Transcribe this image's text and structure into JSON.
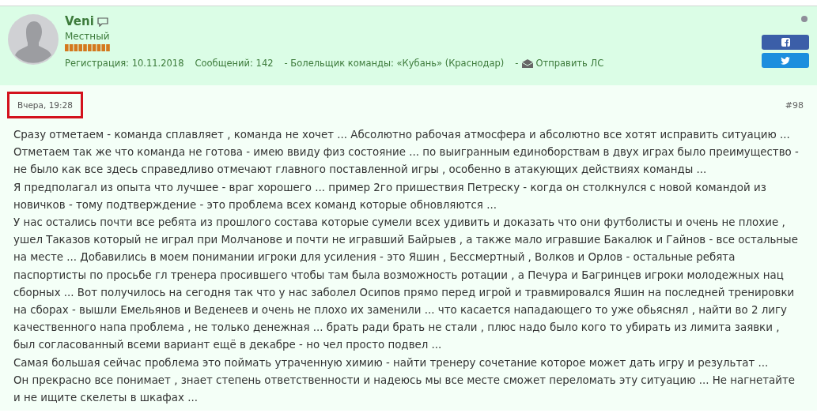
{
  "author": {
    "name": "Veni",
    "rank": "Местный",
    "online": false,
    "registration": "Регистрация: 10.11.2018",
    "messages": "Сообщений: 142",
    "fan": "- Болельщик команды: «Кубань» (Краснодар)",
    "separator": "-",
    "pm_link": "Отправить ЛС"
  },
  "post": {
    "date": "Вчера, 19:28",
    "date_highlighted": true,
    "number": "#98",
    "paragraphs": [
      "Сразу отметаем - команда сплавляет , команда не хочет ... Абсолютно рабочая атмосфера и абсолютно все хотят исправить ситуацию ... Отметаем так же что команда не готова - имею ввиду физ состояние ... по выигранным единоборствам в двух играх было преимущество - не было как все здесь справедливо отмечают главного поставленной игры , особенно в атакующих действиях команды ...",
      "Я предполагал из опыта что лучшее - враг хорошего ... пример 2го пришествия Петреску - когда он столкнулся с новой командой из новичков - тому подтверждение - это проблема всех команд которые обновляются ...",
      "У нас остались почти все ребята из прошлого состава которые сумели всех удивить и доказать что они футболисты и очень не плохие , ушел Таказов который не играл при Молчанове и почти не игравший Байрыев , а также мало игравшие Бакалюк и Гайнов - все остальные на месте ... Добавились в моем понимании игроки для усиления - это Яшин , Бессмертный , Волков и Орлов - остальные ребята паспортисты по просьбе гл тренера просившего чтобы там была возможность ротации , а Печура и Багринцев игроки молодежных нац сборных ... Вот получилось на сегодня так что у нас заболел Осипов прямо перед игрой и травмировался Яшин на последней тренировки на сборах - вышли Емельянов и Веденеев и очень не плохо их заменили ... что касается нападающего то уже обьяснял , найти во 2 лигу качественного напа проблема , не только денежная ... брать ради брать не стали , плюс надо было кого то убирать из лимита заявки , был согласованный всеми вариант ещё в декабре - но чел просто подвел ...",
      "Самая большая сейчас проблема это поймать утраченную химию - найти тренеру сочетание которое может дать игру и результат ...",
      "Он прекрасно все понимает , знает степень ответственности и надеюсь мы все месте сможет переломать эту ситуацию ... Не нагнетайте и не ищите скелеты в шкафах ..."
    ]
  }
}
